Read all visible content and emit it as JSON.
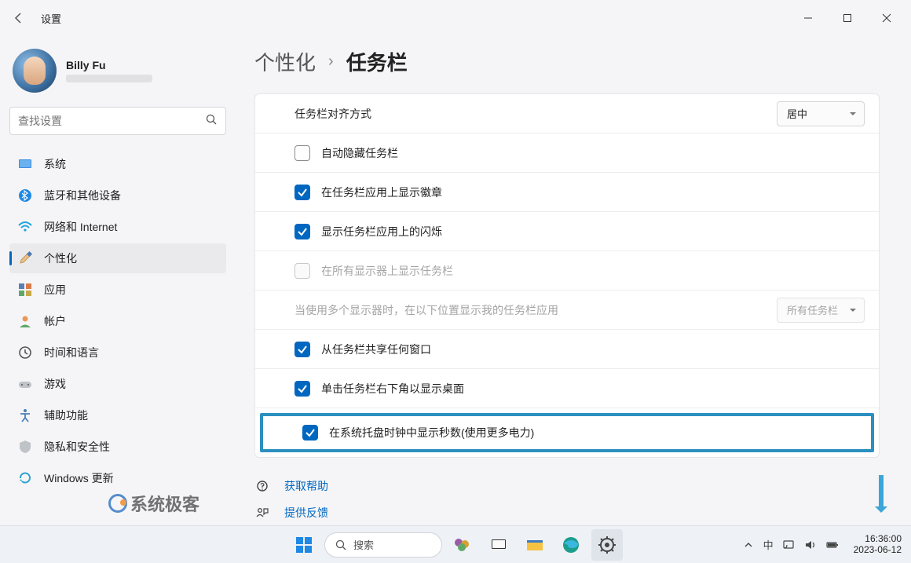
{
  "window": {
    "title": "设置"
  },
  "profile": {
    "name": "Billy Fu"
  },
  "search": {
    "placeholder": "查找设置"
  },
  "sidebar": {
    "items": [
      {
        "label": "系统",
        "icon": "display"
      },
      {
        "label": "蓝牙和其他设备",
        "icon": "bluetooth"
      },
      {
        "label": "网络和 Internet",
        "icon": "wifi"
      },
      {
        "label": "个性化",
        "icon": "brush",
        "active": true
      },
      {
        "label": "应用",
        "icon": "apps"
      },
      {
        "label": "帐户",
        "icon": "person"
      },
      {
        "label": "时间和语言",
        "icon": "clock"
      },
      {
        "label": "游戏",
        "icon": "gamepad"
      },
      {
        "label": "辅助功能",
        "icon": "accessibility"
      },
      {
        "label": "隐私和安全性",
        "icon": "shield"
      },
      {
        "label": "Windows 更新",
        "icon": "update"
      }
    ]
  },
  "breadcrumb": {
    "parent": "个性化",
    "current": "任务栏"
  },
  "settings": {
    "alignment": {
      "label": "任务栏对齐方式",
      "value": "居中"
    },
    "autohide": {
      "label": "自动隐藏任务栏",
      "checked": false
    },
    "show_badges": {
      "label": "在任务栏应用上显示徽章",
      "checked": true
    },
    "show_flashing": {
      "label": "显示任务栏应用上的闪烁",
      "checked": true
    },
    "all_displays": {
      "label": "在所有显示器上显示任务栏",
      "checked": false,
      "disabled": true
    },
    "multi_display": {
      "label": "当使用多个显示器时，在以下位置显示我的任务栏应用",
      "value": "所有任务栏",
      "disabled": true
    },
    "share_window": {
      "label": "从任务栏共享任何窗口",
      "checked": true
    },
    "click_corner": {
      "label": "单击任务栏右下角以显示桌面",
      "checked": true
    },
    "show_seconds": {
      "label": "在系统托盘时钟中显示秒数(使用更多电力)",
      "checked": true,
      "highlighted": true
    }
  },
  "help": {
    "get_help": "获取帮助",
    "feedback": "提供反馈"
  },
  "watermark": "系统极客",
  "taskbar": {
    "search_placeholder": "搜索",
    "ime": "中",
    "time": "16:36:00",
    "date": "2023-06-12"
  },
  "colors": {
    "accent": "#0067c0",
    "highlight": "#2b8fbf"
  }
}
